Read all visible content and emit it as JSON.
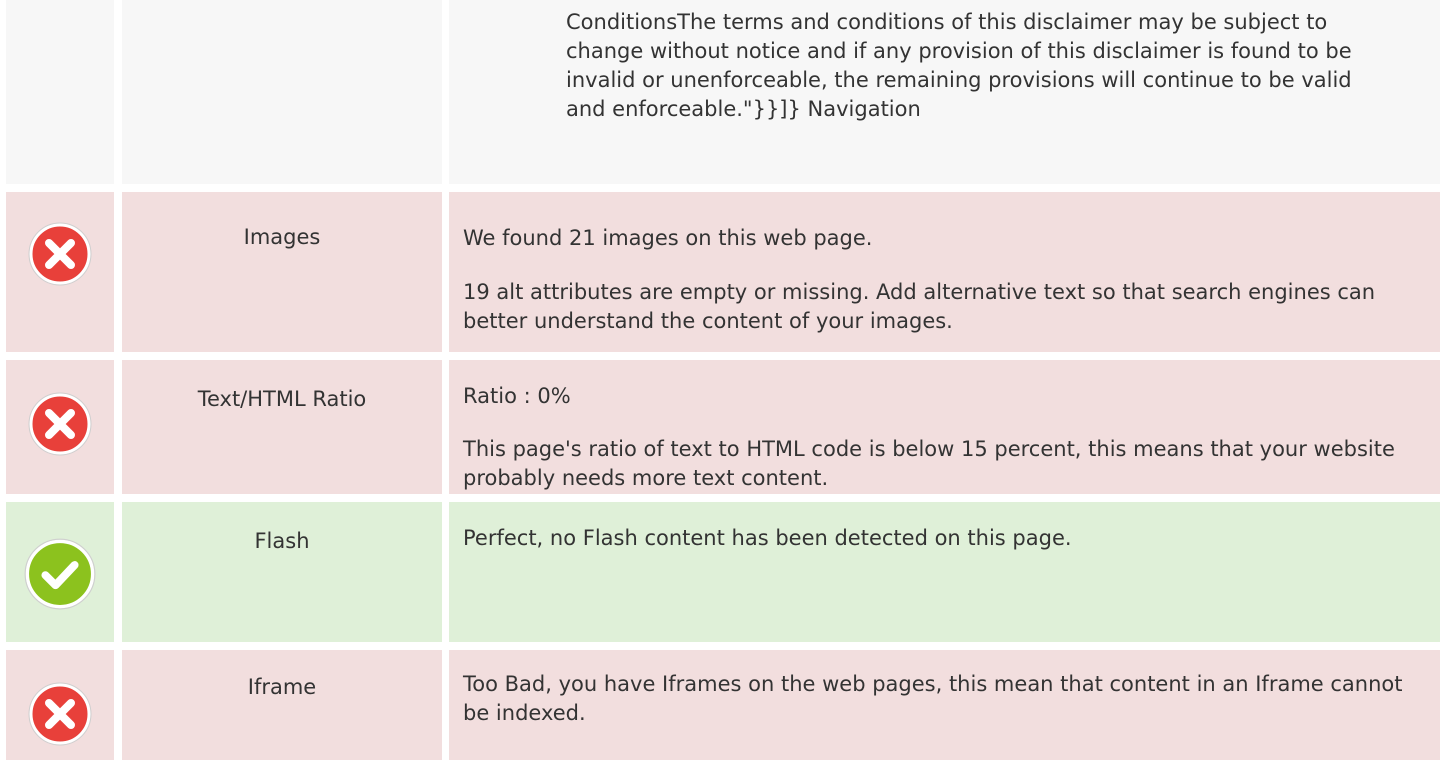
{
  "top_section": {
    "text": "ConditionsThe terms and conditions of this disclaimer may be subject to change without notice and if any provision of this disclaimer is found to be invalid or unenforceable, the remaining provisions will continue to be valid and enforceable.\"}}]} Navigation"
  },
  "rows": [
    {
      "status": "error",
      "icon": "error-x-icon",
      "label": "Images",
      "paragraphs": [
        "We found 21 images on this web page.",
        "19 alt attributes are empty or missing. Add alternative text so that search engines can better understand the content of your images."
      ]
    },
    {
      "status": "error",
      "icon": "error-x-icon",
      "label": "Text/HTML Ratio",
      "paragraphs": [
        "Ratio : 0%",
        "This page's ratio of text to HTML code is below 15 percent, this means that your website probably needs more text content."
      ]
    },
    {
      "status": "success",
      "icon": "success-check-icon",
      "label": "Flash",
      "paragraphs": [
        "Perfect, no Flash content has been detected on this page."
      ]
    },
    {
      "status": "error",
      "icon": "error-x-icon",
      "label": "Iframe",
      "paragraphs": [
        "Too Bad, you have Iframes on the web pages, this mean that content in an Iframe cannot be indexed."
      ]
    }
  ],
  "colors": {
    "error_bg": "#f2dede",
    "success_bg": "#dff0d8",
    "plain_bg": "#f7f7f7",
    "error_icon": "#e8403a",
    "success_icon": "#8cc21e"
  }
}
